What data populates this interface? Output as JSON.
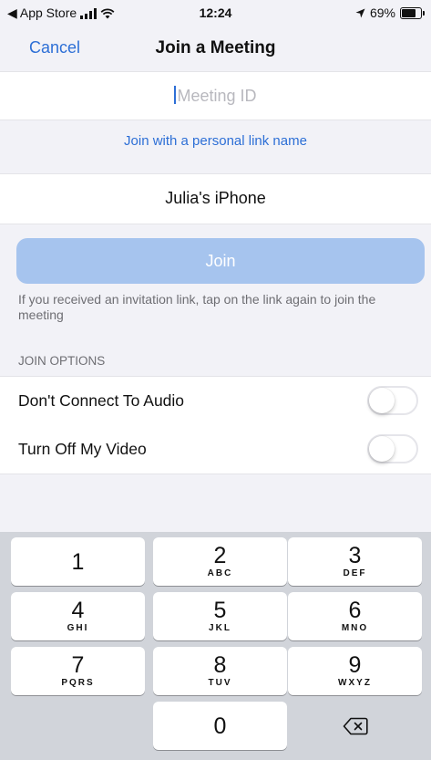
{
  "status_bar": {
    "back_app": "◀ App Store",
    "time": "12:24",
    "battery": "69%",
    "battery_level": 0.69
  },
  "nav": {
    "cancel": "Cancel",
    "title": "Join a Meeting"
  },
  "form": {
    "meeting_id_placeholder": "Meeting ID",
    "personal_link": "Join with a personal link name",
    "name_value": "Julia's iPhone",
    "join_button": "Join",
    "hint": "If you received an invitation link, tap on the link again to join the meeting"
  },
  "join_options": {
    "header": "JOIN OPTIONS",
    "items": [
      {
        "label": "Don't Connect To Audio",
        "on": false
      },
      {
        "label": "Turn Off My Video",
        "on": false
      }
    ]
  },
  "keypad": {
    "keys": [
      {
        "digit": "1",
        "letters": ""
      },
      {
        "digit": "2",
        "letters": "ABC"
      },
      {
        "digit": "3",
        "letters": "DEF"
      },
      {
        "digit": "4",
        "letters": "GHI"
      },
      {
        "digit": "5",
        "letters": "JKL"
      },
      {
        "digit": "6",
        "letters": "MNO"
      },
      {
        "digit": "7",
        "letters": "PQRS"
      },
      {
        "digit": "8",
        "letters": "TUV"
      },
      {
        "digit": "9",
        "letters": "WXYZ"
      },
      {
        "digit": "0",
        "letters": ""
      }
    ],
    "backspace_icon": "backspace-icon"
  },
  "colors": {
    "accent": "#2d6fd6",
    "join_disabled": "#a6c4ee",
    "keyboard_bg": "#d1d4da"
  }
}
